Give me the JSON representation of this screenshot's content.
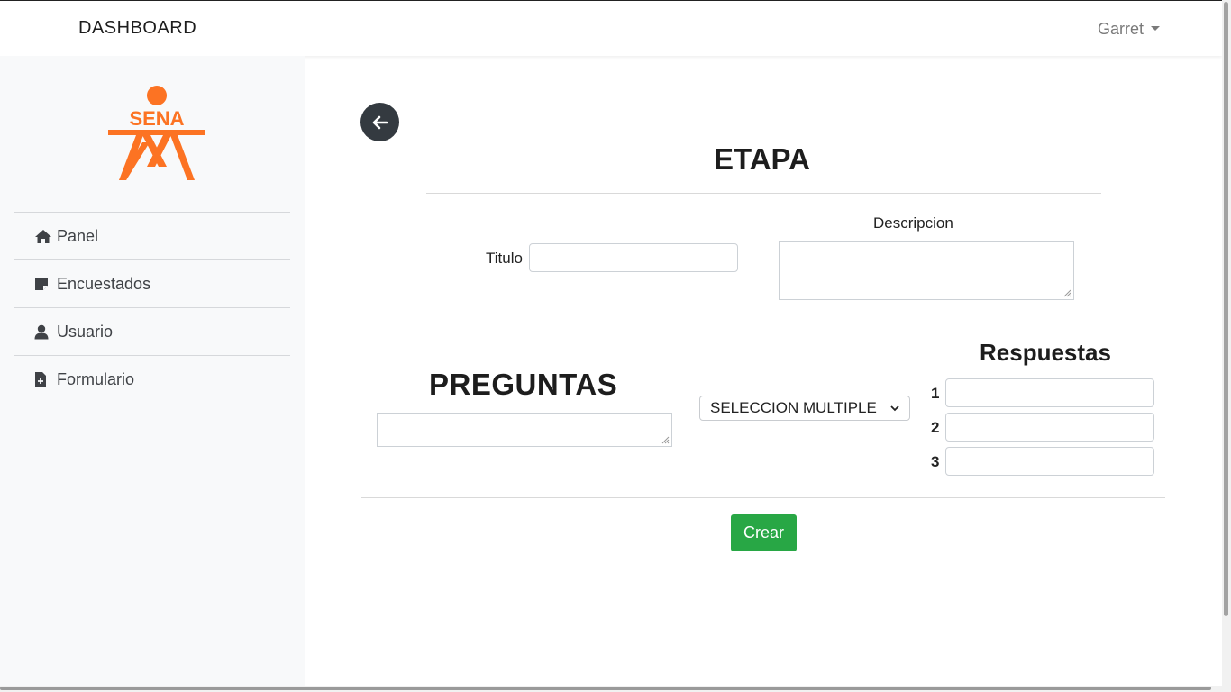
{
  "header": {
    "brand": "DASHBOARD",
    "user": "Garret"
  },
  "sidebar": {
    "logo_text": "SENA",
    "items": [
      {
        "label": "Panel",
        "icon": "home-icon"
      },
      {
        "label": "Encuestados",
        "icon": "sticky-note-icon"
      },
      {
        "label": "Usuario",
        "icon": "user-icon"
      },
      {
        "label": "Formulario",
        "icon": "file-plus-icon"
      }
    ]
  },
  "form": {
    "heading": "ETAPA",
    "titulo_label": "Titulo",
    "titulo_value": "",
    "descripcion_label": "Descripcion",
    "descripcion_value": "",
    "preguntas_heading": "PREGUNTAS",
    "pregunta_value": "",
    "question_type": "SELECCION MULTIPLE",
    "respuestas_heading": "Respuestas",
    "answers": [
      {
        "num": "1",
        "value": ""
      },
      {
        "num": "2",
        "value": ""
      },
      {
        "num": "3",
        "value": ""
      }
    ],
    "submit_label": "Crear"
  },
  "colors": {
    "brand_orange": "#fc7323",
    "success": "#28a745",
    "dark": "#343a40"
  }
}
